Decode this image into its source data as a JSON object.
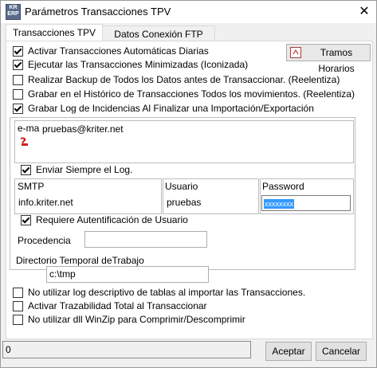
{
  "window": {
    "title": "Parámetros Transacciones TPV",
    "icon_text": [
      "KR",
      "ERP"
    ],
    "close_glyph": "✕"
  },
  "tabs": [
    {
      "label": "Transacciones TPV",
      "active": true
    },
    {
      "label": "Datos Conexión FTP",
      "active": false
    }
  ],
  "tramos_button": {
    "label": "Tramos Horarios",
    "icon": "calendar-icon"
  },
  "options_top": [
    {
      "label": "Activar Transacciones Automáticas Diarias",
      "checked": true
    },
    {
      "label": "Ejecutar las Transacciones Minimizadas (Iconizada)",
      "checked": true
    },
    {
      "label": "Realizar Backup de Todos los Datos antes de Transaccionar. (Reelentiza)",
      "checked": false
    },
    {
      "label": "Grabar en el Histórico de Transacciones Todos los movimientos. (Reelentiza)",
      "checked": false
    },
    {
      "label": "Grabar Log de Incidencias Al Finalizar una Importación/Exportación",
      "checked": true
    }
  ],
  "email": {
    "label": "e-mail",
    "value": "pruebas@kriter.net",
    "icon": "red-question-icon"
  },
  "send_log": {
    "label": "Enviar Siempre el Log.",
    "checked": true
  },
  "smtp": {
    "label": "SMTP",
    "value": "info.kriter.net"
  },
  "usuario": {
    "label": "Usuario",
    "value": "pruebas"
  },
  "password": {
    "label": "Password",
    "value": "xxxxxxxx"
  },
  "auth": {
    "label": "Requiere Autentificación de Usuario",
    "checked": true
  },
  "procedencia": {
    "label": "Procedencia",
    "value": ""
  },
  "directorio": {
    "label": "Directorio Temporal deTrabajo",
    "value": "c:\\tmp"
  },
  "options_bottom": [
    {
      "label": "No utilizar log descriptivo de tablas al importar las Transacciones.",
      "checked": false
    },
    {
      "label": "Activar Trazabilidad Total al Transaccionar",
      "checked": false
    },
    {
      "label": "No utilizar dll WinZip para Comprimir/Descomprimir",
      "checked": false
    }
  ],
  "status_value": "0",
  "buttons": {
    "accept": "Aceptar",
    "cancel": "Cancelar"
  },
  "colors": {
    "password_selection": "#3399ff"
  }
}
